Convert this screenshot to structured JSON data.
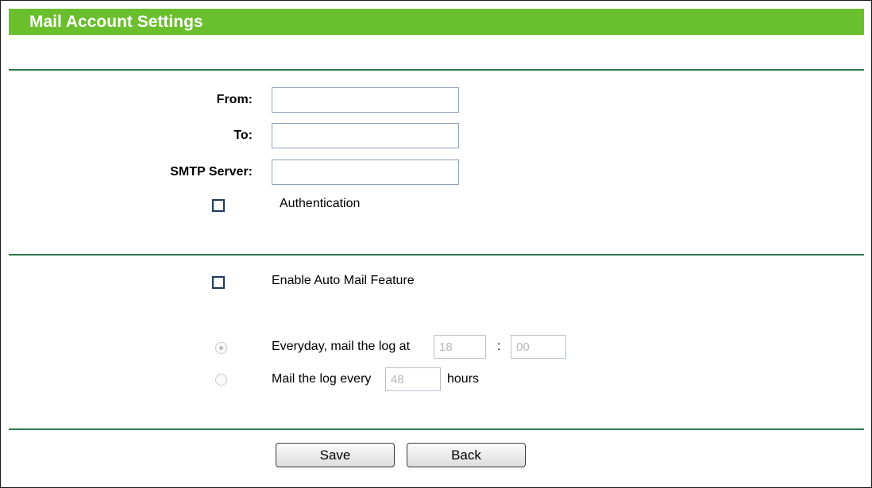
{
  "header": {
    "title": "Mail Account Settings"
  },
  "account": {
    "from_label": "From:",
    "from_value": "",
    "to_label": "To:",
    "to_value": "",
    "smtp_label": "SMTP Server:",
    "smtp_value": "",
    "auth_label": "Authentication",
    "auth_checked": false
  },
  "auto_mail": {
    "enable_label": "Enable Auto Mail Feature",
    "enable_checked": false,
    "daily_label": "Everyday, mail the log at",
    "daily_hour": "18",
    "time_separator": ":",
    "daily_minute": "00",
    "interval_label_prefix": "Mail the log every",
    "interval_hours": "48",
    "interval_label_suffix": "hours",
    "selected_mode": "daily"
  },
  "buttons": {
    "save_label": "Save",
    "back_label": "Back"
  },
  "colors": {
    "header_bg": "#6abf2c",
    "rule": "#2a7a4a",
    "input_border": "#8fa2b9"
  }
}
